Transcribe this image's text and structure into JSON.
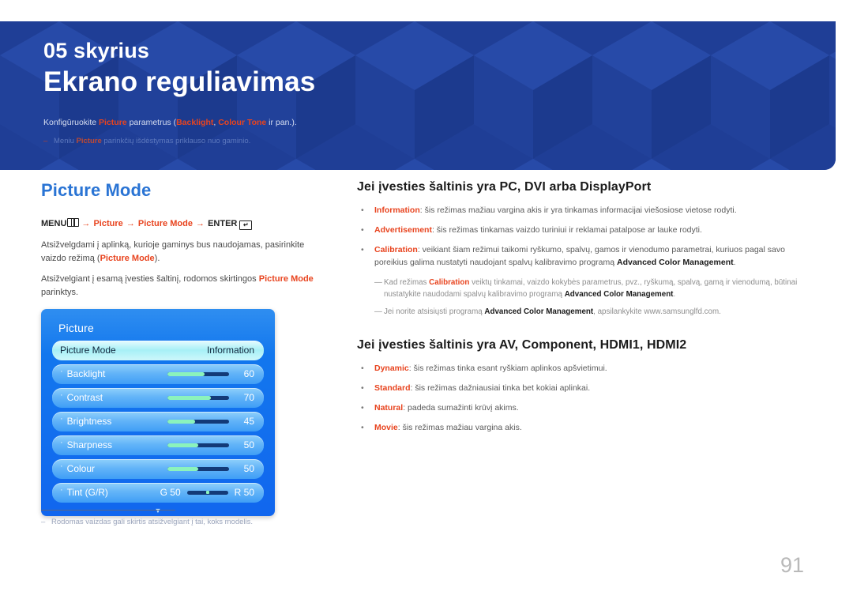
{
  "header": {
    "chapter_label": "05 skyrius",
    "chapter_title": "Ekrano reguliavimas",
    "description_pre": "Konfigūruokite ",
    "description_kw1": "Picture",
    "description_mid": " parametrus (",
    "description_kw2": "Backlight",
    "description_sep": ", ",
    "description_kw3": "Colour Tone",
    "description_post": " ir pan.).",
    "note_dash": "‒",
    "note_pre": "Meniu ",
    "note_kw": "Picture",
    "note_post": " parinkčių išdėstymas priklauso nuo gaminio.",
    "accent_color": "#e8441f",
    "background_color": "#1f3e96"
  },
  "left": {
    "section_title": "Picture Mode",
    "menu_path": {
      "menu_label": "MENU",
      "menu_icon": "menu-grid-icon",
      "arrow1": "→",
      "item1": "Picture",
      "arrow2": "→",
      "item2": "Picture Mode",
      "arrow3": "→",
      "enter_label": "ENTER",
      "enter_icon": "enter-return-icon",
      "enter_glyph": "↵"
    },
    "paragraph1_a": "Atsižvelgdami į aplinką, kurioje gaminys bus naudojamas, pasirinkite vaizdo režimą (",
    "paragraph1_b": "Picture Mode",
    "paragraph1_c": ").",
    "paragraph2_a": "Atsižvelgiant į esamą įvesties šaltinį, rodomos skirtingos ",
    "paragraph2_b": "Picture Mode",
    "paragraph2_c": " parinktys."
  },
  "osd": {
    "title": "Picture",
    "selected_row": {
      "label": "Picture Mode",
      "value": "Information"
    },
    "rows": [
      {
        "label": "Backlight",
        "value": "60",
        "fill_percent": 60
      },
      {
        "label": "Contrast",
        "value": "70",
        "fill_percent": 70
      },
      {
        "label": "Brightness",
        "value": "45",
        "fill_percent": 45
      },
      {
        "label": "Sharpness",
        "value": "50",
        "fill_percent": 50
      },
      {
        "label": "Colour",
        "value": "50",
        "fill_percent": 50
      }
    ],
    "tint_row": {
      "label": "Tint (G/R)",
      "green_label": "G 50",
      "red_label": "R 50"
    },
    "scroll_arrow": "▼"
  },
  "footnote": {
    "dash": "‒",
    "text": "Rodomas vaizdas gali skirtis atsižvelgiant į tai, koks modelis."
  },
  "right": {
    "heading1": "Jei įvesties šaltinis yra PC, DVI arba DisplayPort",
    "bullets1": [
      {
        "marker": "•",
        "term": "Information",
        "sep": ": ",
        "text": "šis režimas mažiau vargina akis ir yra tinkamas informacijai viešosiose vietose rodyti."
      },
      {
        "marker": "•",
        "term": "Advertisement",
        "sep": ": ",
        "text": "šis režimas tinkamas vaizdo turiniui ir reklamai patalpose ar lauke rodyti."
      },
      {
        "marker": "•",
        "term": "Calibration",
        "sep": ": ",
        "text": "veikiant šiam režimui taikomi ryškumo, spalvų, gamos ir vienodumo parametrai, kuriuos pagal savo poreikius galima nustatyti naudojant spalvų kalibravimo programą ",
        "bold_tail": "Advanced Color Management",
        "tail": "."
      }
    ],
    "subnotes": [
      {
        "dash": "—",
        "pre": "Kad režimas ",
        "term": "Calibration",
        "mid": " veiktų tinkamai, vaizdo kokybės parametrus, pvz., ryškumą, spalvą, gamą ir vienodumą, būtinai nustatykite naudodami spalvų kalibravimo programą ",
        "bold_tail": "Advanced Color Management",
        "tail": "."
      },
      {
        "dash": "—",
        "pre": "Jei norite atsisiųsti programą ",
        "bold_tail": "Advanced Color Management",
        "tail": ", apsilankykite www.samsunglfd.com."
      }
    ],
    "heading2": "Jei įvesties šaltinis yra AV, Component, HDMI1, HDMI2",
    "bullets2": [
      {
        "marker": "•",
        "term": "Dynamic",
        "sep": ": ",
        "text": "šis režimas tinka esant ryškiam aplinkos apšvietimui."
      },
      {
        "marker": "•",
        "term": "Standard",
        "sep": ": ",
        "text": "šis režimas dažniausiai tinka bet kokiai aplinkai."
      },
      {
        "marker": "•",
        "term": "Natural",
        "sep": ": ",
        "text": "padeda sumažinti krūvį akims."
      },
      {
        "marker": "•",
        "term": "Movie",
        "sep": ": ",
        "text": "šis režimas mažiau vargina akis."
      }
    ]
  },
  "page": {
    "number": "91"
  }
}
